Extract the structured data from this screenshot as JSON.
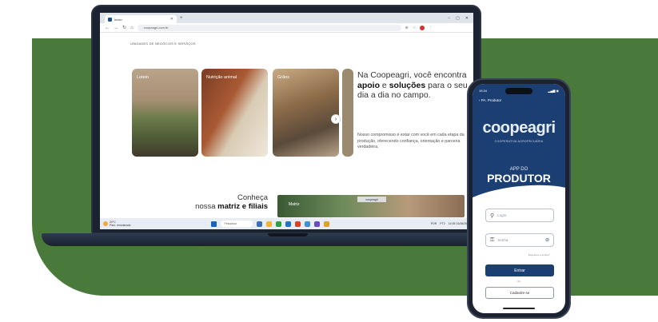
{
  "browser": {
    "tab_title": "Início",
    "url": "coopeagri.com.br",
    "new_tab": "+",
    "window_controls": [
      "–",
      "▢",
      "✕"
    ]
  },
  "page": {
    "section_label": "UNIDADES DE NEGÓCIOS E SERVIÇOS",
    "cards": [
      "Loteio",
      "Nutrição animal",
      "Grãos"
    ],
    "headline_1": "Na Coopeagri, você encontra ",
    "headline_bold_1": "apoio",
    "headline_2": " e ",
    "headline_bold_2": "soluções",
    "headline_3": " para o seu dia a dia no campo.",
    "body": "Nosso compromisso é estar com você em cada etapa da produção, oferecendo confiança, orientação e parceria verdadeira.",
    "conheca_line1": "Conheça",
    "conheca_line2_prefix": "nossa ",
    "conheca_bold": "matriz e filiais",
    "photo_label": "Matriz",
    "photo_sign": "coopeagri"
  },
  "taskbar": {
    "weather_temp": "20°C",
    "weather_text": "Parc. ensolarado",
    "search": "Pesquisar",
    "tray": [
      "POR",
      "PT2",
      "14:05",
      "01/06/2025"
    ]
  },
  "phone": {
    "time": "15:34",
    "status_icons": "▂▄▆ ◉",
    "back_label": "PA. Produtor",
    "logo": "coopeagri",
    "subtitle": "COOPERATIVA AGROPECUÁRIA",
    "app_do": "APP DO",
    "produtor": "PRODUTOR",
    "login_placeholder": "Login",
    "senha_placeholder": "Senha",
    "forgot": "Esqueceu a senha?",
    "entrar": "Entrar",
    "ou": "ou",
    "cadastre": "Cadastre-se"
  },
  "colors": {
    "green": "#4a7a3b",
    "navy": "#1b3f73"
  }
}
